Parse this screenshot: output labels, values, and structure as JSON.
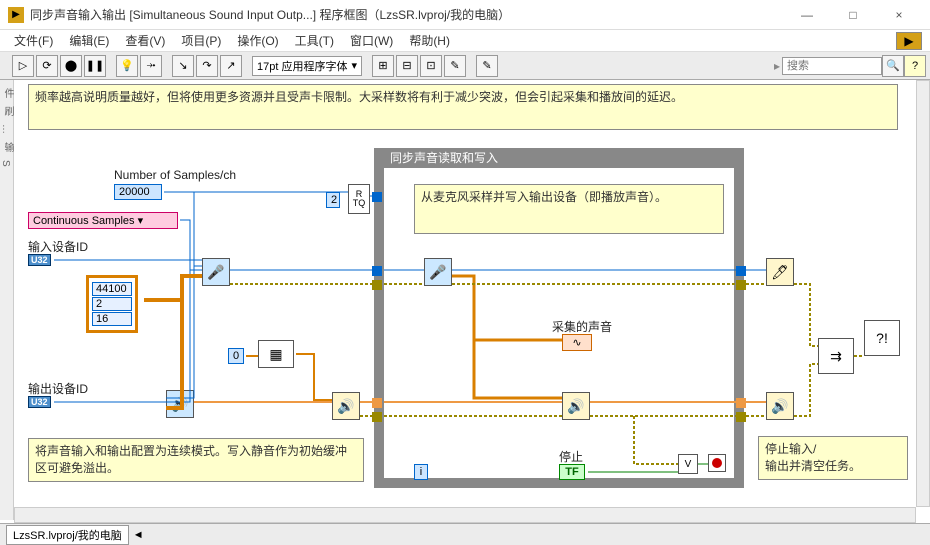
{
  "window": {
    "title": "同步声音输入输出 [Simultaneous Sound Input Outp...] 程序框图（LzsSR.lvproj/我的电脑）",
    "min": "—",
    "max": "□",
    "close": "×"
  },
  "menu": {
    "file": "文件(F)",
    "edit": "编辑(E)",
    "view": "查看(V)",
    "project": "项目(P)",
    "operate": "操作(O)",
    "tools": "工具(T)",
    "window": "窗口(W)",
    "help": "帮助(H)"
  },
  "toolbar": {
    "font": "17pt 应用程序字体",
    "search_placeholder": "搜索"
  },
  "comments": {
    "top": "频率越高说明质量越好，但将使用更多资源并且受声卡限制。大采样数将有利于减少突波，但会引起采集和播放间的延迟。",
    "loop": "从麦克风采样并写入输出设备（即播放声音）。",
    "left": "将声音输入和输出配置为连续模式。写入静音作为初始缓冲区可避免溢出。",
    "right": "停止输入/\n输出并清空任务。"
  },
  "labels": {
    "num_samples": "Number of Samples/ch",
    "cont_samples": "Continuous Samples",
    "input_dev": "输入设备ID",
    "output_dev": "输出设备ID",
    "collected": "采集的声音",
    "stop": "停止",
    "loop_title": "同步声音读取和写入"
  },
  "values": {
    "samples": "20000",
    "q_const": "2",
    "rate": "44100",
    "channels": "2",
    "bits": "16",
    "zero": "0",
    "u32": "U32",
    "tf": "TF",
    "wav": "∿",
    "i_loop": "i",
    "rtq": "R\nTQ"
  },
  "icons": {
    "run": "▷",
    "run_cont": "⟳",
    "abort": "⬤",
    "pause": "❚❚",
    "bulb": "💡",
    "retain": "⤞",
    "step_into": "↘",
    "step_over": "↷",
    "step_out": "↗",
    "dropdown": "▾",
    "align": "⊞",
    "distribute": "⊟",
    "reorder": "⊡",
    "cleanup": "✎",
    "search": "🔍",
    "help": "?",
    "mic_in": "🎤",
    "mic_cfg": "🎤",
    "read": "📖",
    "write": "🔊",
    "speaker": "🔊",
    "clear": "🖊",
    "array": "▦",
    "merge": "⇉",
    "error": "?!",
    "v": "V"
  },
  "bottom": {
    "project": "LzsSR.lvproj/我的电脑",
    "arrow": "◄"
  }
}
